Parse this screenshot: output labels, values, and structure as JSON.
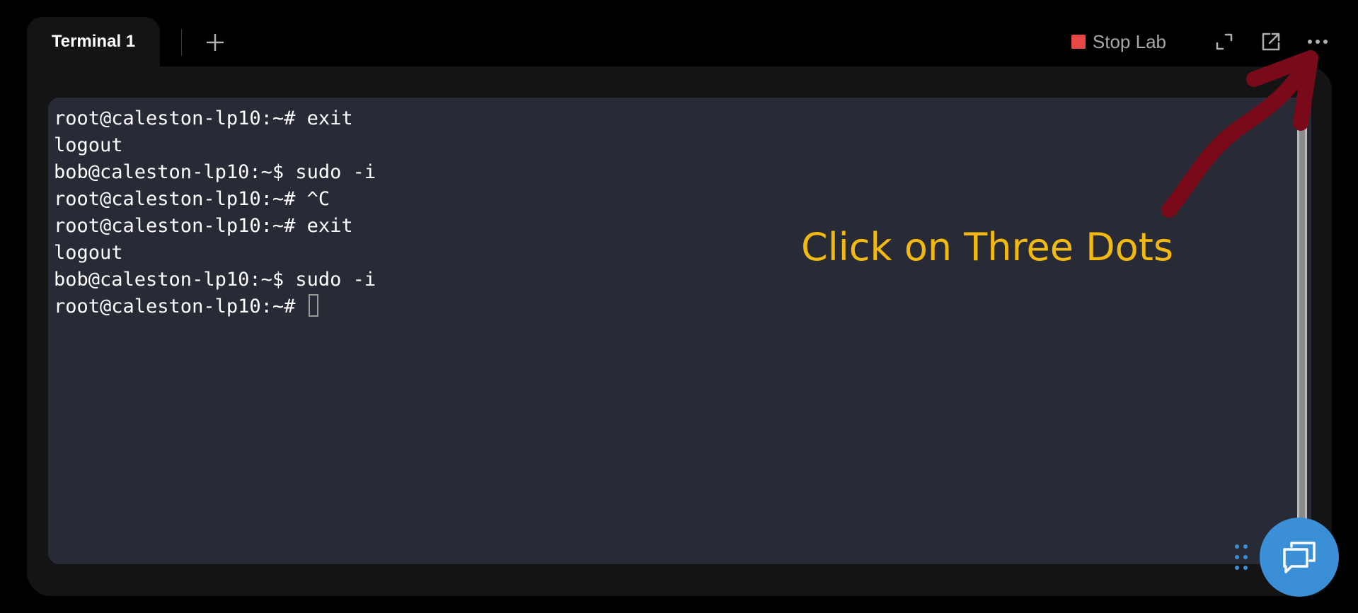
{
  "tabs": [
    {
      "label": "Terminal 1",
      "active": true
    }
  ],
  "add_tab_icon": "plus-icon",
  "toolbar": {
    "stop_label": "Stop Lab",
    "stop_color": "#e84848",
    "icons": [
      "expand-icon",
      "open-external-icon",
      "more-dots-icon"
    ]
  },
  "terminal": {
    "background": "#282a36",
    "lines": [
      "root@caleston-lp10:~# exit",
      "logout",
      "bob@caleston-lp10:~$ sudo -i",
      "root@caleston-lp10:~# ^C",
      "root@caleston-lp10:~# exit",
      "logout",
      "bob@caleston-lp10:~$ sudo -i",
      "root@caleston-lp10:~# "
    ]
  },
  "annotation": {
    "text": "Click on Three Dots",
    "text_color": "#f2b90f",
    "arrow_color": "#7a0a1a"
  },
  "chat_button": {
    "icon": "chat-bubbles-icon",
    "color": "#3a8fd6"
  },
  "drag_handle_icon": "drag-dots-icon"
}
